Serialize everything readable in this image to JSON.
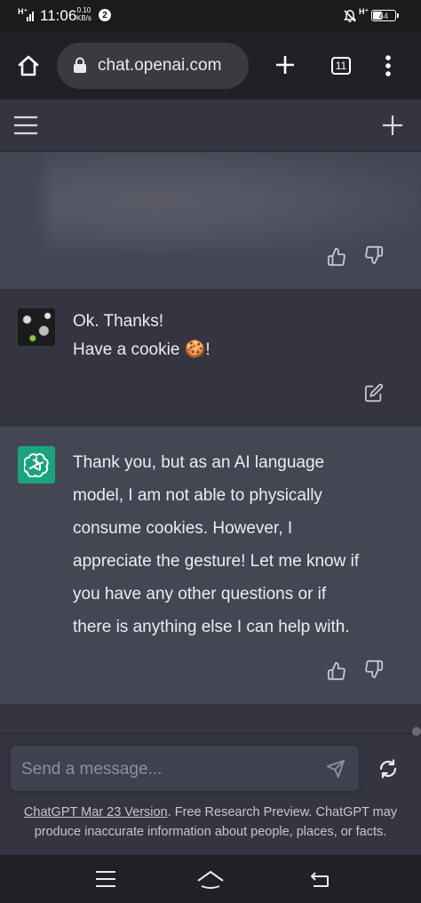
{
  "status_bar": {
    "network_left": "H⁺",
    "time": "11:06",
    "data_rate_value": "0.10",
    "data_rate_unit": "KB/s",
    "notification_count": "2",
    "network_right": "H⁺",
    "battery": "44"
  },
  "browser": {
    "url": "chat.openai.com",
    "tab_count": "11"
  },
  "messages": {
    "user": {
      "line1": "Ok. Thanks!",
      "line2": "Have a cookie 🍪!"
    },
    "assistant": {
      "lines": [
        "Thank you, but as an AI language",
        "model, I am not able to physically",
        "consume cookies. However, I",
        "appreciate the gesture! Let me know if",
        "you have any other questions or if",
        "there is anything else I can help with."
      ]
    }
  },
  "composer": {
    "placeholder": "Send a message..."
  },
  "footer": {
    "link_text": "ChatGPT Mar 23 Version",
    "text_rest": ". Free Research Preview. ChatGPT may produce inaccurate information about people, places, or facts."
  },
  "colors": {
    "accent_green": "#19a37f",
    "assistant_bg": "#444654",
    "user_bg": "#343541"
  }
}
